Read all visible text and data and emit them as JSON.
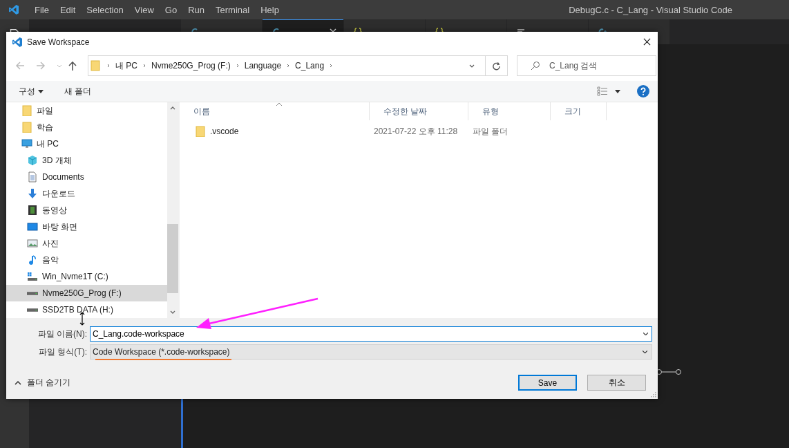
{
  "vscode": {
    "menu": [
      "File",
      "Edit",
      "Selection",
      "View",
      "Go",
      "Run",
      "Terminal",
      "Help"
    ],
    "title": "DebugC.c - C_Lang - Visual Studio Code",
    "tabs": [
      {
        "kind": "c",
        "selected": false
      },
      {
        "kind": "c",
        "selected": true
      },
      {
        "kind": "json",
        "selected": false
      },
      {
        "kind": "json",
        "selected": false
      },
      {
        "kind": "settings",
        "selected": false
      },
      {
        "kind": "cpp",
        "selected": false
      }
    ]
  },
  "dialog": {
    "title": "Save Workspace",
    "breadcrumb": [
      "내 PC",
      "Nvme250G_Prog (F:)",
      "Language",
      "C_Lang"
    ],
    "search": {
      "placeholder": "C_Lang 검색"
    },
    "toolbar": {
      "organize": "구성",
      "new_folder": "새 폴더"
    },
    "nav": [
      {
        "label": "파일",
        "kind": "folder",
        "selected": false
      },
      {
        "label": "학습",
        "kind": "folder",
        "selected": false
      },
      {
        "label": "내 PC",
        "kind": "pc",
        "selected": false,
        "children": [
          {
            "label": "3D 개체",
            "kind": "cube",
            "selected": false
          },
          {
            "label": "Documents",
            "kind": "document",
            "selected": false
          },
          {
            "label": "다운로드",
            "kind": "download",
            "selected": false
          },
          {
            "label": "동영상",
            "kind": "video",
            "selected": false
          },
          {
            "label": "바탕 화면",
            "kind": "desktop",
            "selected": false
          },
          {
            "label": "사진",
            "kind": "image",
            "selected": false
          },
          {
            "label": "음악",
            "kind": "music",
            "selected": false
          },
          {
            "label": "Win_Nvme1T (C:)",
            "kind": "windrive",
            "selected": false
          },
          {
            "label": "Nvme250G_Prog (F:)",
            "kind": "drive",
            "selected": true
          },
          {
            "label": "SSD2TB DATA (H:)",
            "kind": "drive",
            "selected": false
          }
        ]
      }
    ],
    "columns": [
      {
        "label": "이름",
        "sorted": true
      },
      {
        "label": "수정한 날짜",
        "sorted": false
      },
      {
        "label": "유형",
        "sorted": false
      },
      {
        "label": "크기",
        "sorted": false
      }
    ],
    "rows": [
      {
        "name": ".vscode",
        "date": "2021-07-22 오후 11:28",
        "type": "파일 폴더",
        "selected": false
      }
    ],
    "file_name": {
      "label": "파일 이름(N):",
      "value": "C_Lang.code-workspace"
    },
    "file_type": {
      "label": "파일 형식(T):",
      "value": "Code Workspace (*.code-workspace)"
    },
    "hide_folders": "폴더 숨기기",
    "buttons": [
      {
        "label": "Save",
        "primary": true
      },
      {
        "label": "취소",
        "primary": false
      }
    ]
  }
}
